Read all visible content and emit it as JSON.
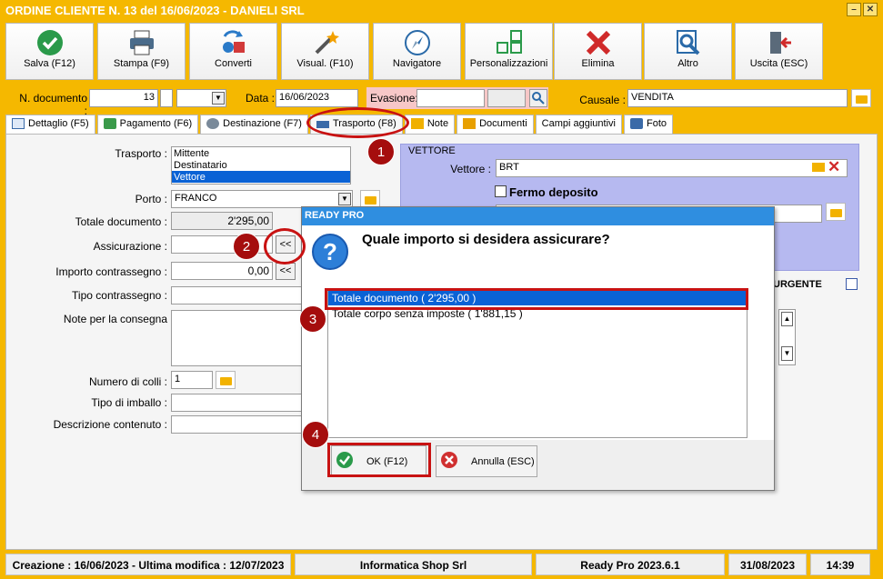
{
  "window": {
    "title": "ORDINE CLIENTE N. 13 del 16/06/2023 - DANIELI SRL"
  },
  "toolbar": [
    {
      "label": "Salva (F12)",
      "icon": "checkmark-icon"
    },
    {
      "label": "Stampa (F9)",
      "icon": "printer-icon"
    },
    {
      "label": "Converti",
      "icon": "convert-icon"
    },
    {
      "label": "Visual. (F10)",
      "icon": "magic-wand-icon"
    },
    {
      "label": "Navigatore",
      "icon": "compass-icon"
    },
    {
      "label": "Personalizzazioni",
      "icon": "grid-icon"
    },
    {
      "label": "Elimina",
      "icon": "delete-x-icon"
    },
    {
      "label": "Altro",
      "icon": "magnifier-icon"
    },
    {
      "label": "Uscita (ESC)",
      "icon": "exit-door-icon"
    }
  ],
  "header": {
    "n_documento_label": "N. documento :",
    "n_documento_value": "13",
    "data_label": "Data :",
    "data_value": "16/06/2023",
    "evasione_label": "Evasione:",
    "causale_label": "Causale :",
    "causale_value": "VENDITA"
  },
  "tabs": [
    {
      "label": "Dettaglio (F5)"
    },
    {
      "label": "Pagamento (F6)"
    },
    {
      "label": "Destinazione (F7)"
    },
    {
      "label": "Trasporto (F8)"
    },
    {
      "label": "Note"
    },
    {
      "label": "Documenti"
    },
    {
      "label": "Campi aggiuntivi"
    },
    {
      "label": "Foto"
    }
  ],
  "form": {
    "trasporto_label": "Trasporto :",
    "trasporto_options": [
      "Mittente",
      "Destinatario",
      "Vettore"
    ],
    "trasporto_selected": "Vettore",
    "porto_label": "Porto :",
    "porto_value": "FRANCO",
    "totale_label": "Totale documento :",
    "totale_value": "2'295,00",
    "assicurazione_label": "Assicurazione :",
    "contrassegno_label": "Importo contrassegno :",
    "contrassegno_value": "0,00",
    "tipo_contrassegno_label": "Tipo contrassegno :",
    "note_label": "Note per la consegna",
    "colli_label": "Numero di colli :",
    "colli_value": "1",
    "imballo_label": "Tipo di imballo :",
    "descrizione_label": "Descrizione contenuto :",
    "copy_button": "<<"
  },
  "vettore": {
    "section_title": "VETTORE",
    "vettore_label": "Vettore :",
    "vettore_value": "BRT",
    "fermo_deposito": "Fermo deposito",
    "urgente": "URGENTE"
  },
  "dialog": {
    "title": "READY PRO",
    "question": "Quale importo si desidera assicurare?",
    "options": [
      "Totale documento ( 2'295,00 )",
      "Totale corpo senza imposte ( 1'881,15 )"
    ],
    "ok_label": "OK (F12)",
    "cancel_label": "Annulla (ESC)"
  },
  "callouts": [
    "1",
    "2",
    "3",
    "4"
  ],
  "statusbar": {
    "created": "Creazione : 16/06/2023 - Ultima modifica : 12/07/2023",
    "company": "Informatica Shop Srl",
    "version": "Ready Pro 2023.6.1",
    "date": "31/08/2023",
    "time": "14:39"
  }
}
